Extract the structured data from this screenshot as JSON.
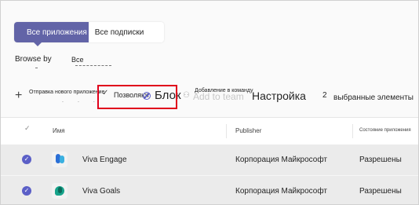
{
  "tabs": [
    {
      "label": "Все приложения",
      "active": true
    },
    {
      "label": "Все подписки",
      "active": false
    }
  ],
  "browse": {
    "label": "Browse by",
    "value": "Все"
  },
  "toolbar": {
    "send_label": "Отправка нового приложение",
    "allow_label": "Позволяют",
    "block_label": "Блок",
    "add_to_team_label": "Добавление в команду",
    "add_to_team_ghost": "Add to team",
    "settings_label": "Настройка",
    "selected_count": "2",
    "selected_label": "выбранные элементы"
  },
  "table": {
    "columns": [
      "Имя",
      "Publisher",
      "Состояние приложения"
    ],
    "rows": [
      {
        "name": "Viva Engage",
        "publisher": "Корпорация Майкрософт",
        "status": "Разрешены",
        "selected": true
      },
      {
        "name": "Viva Goals",
        "publisher": "Корпорация Майкрософт",
        "status": "Разрешены",
        "selected": true
      }
    ]
  },
  "colors": {
    "accent": "#6264a7",
    "highlight": "#e0001b",
    "row_bg": "#ebebeb"
  }
}
